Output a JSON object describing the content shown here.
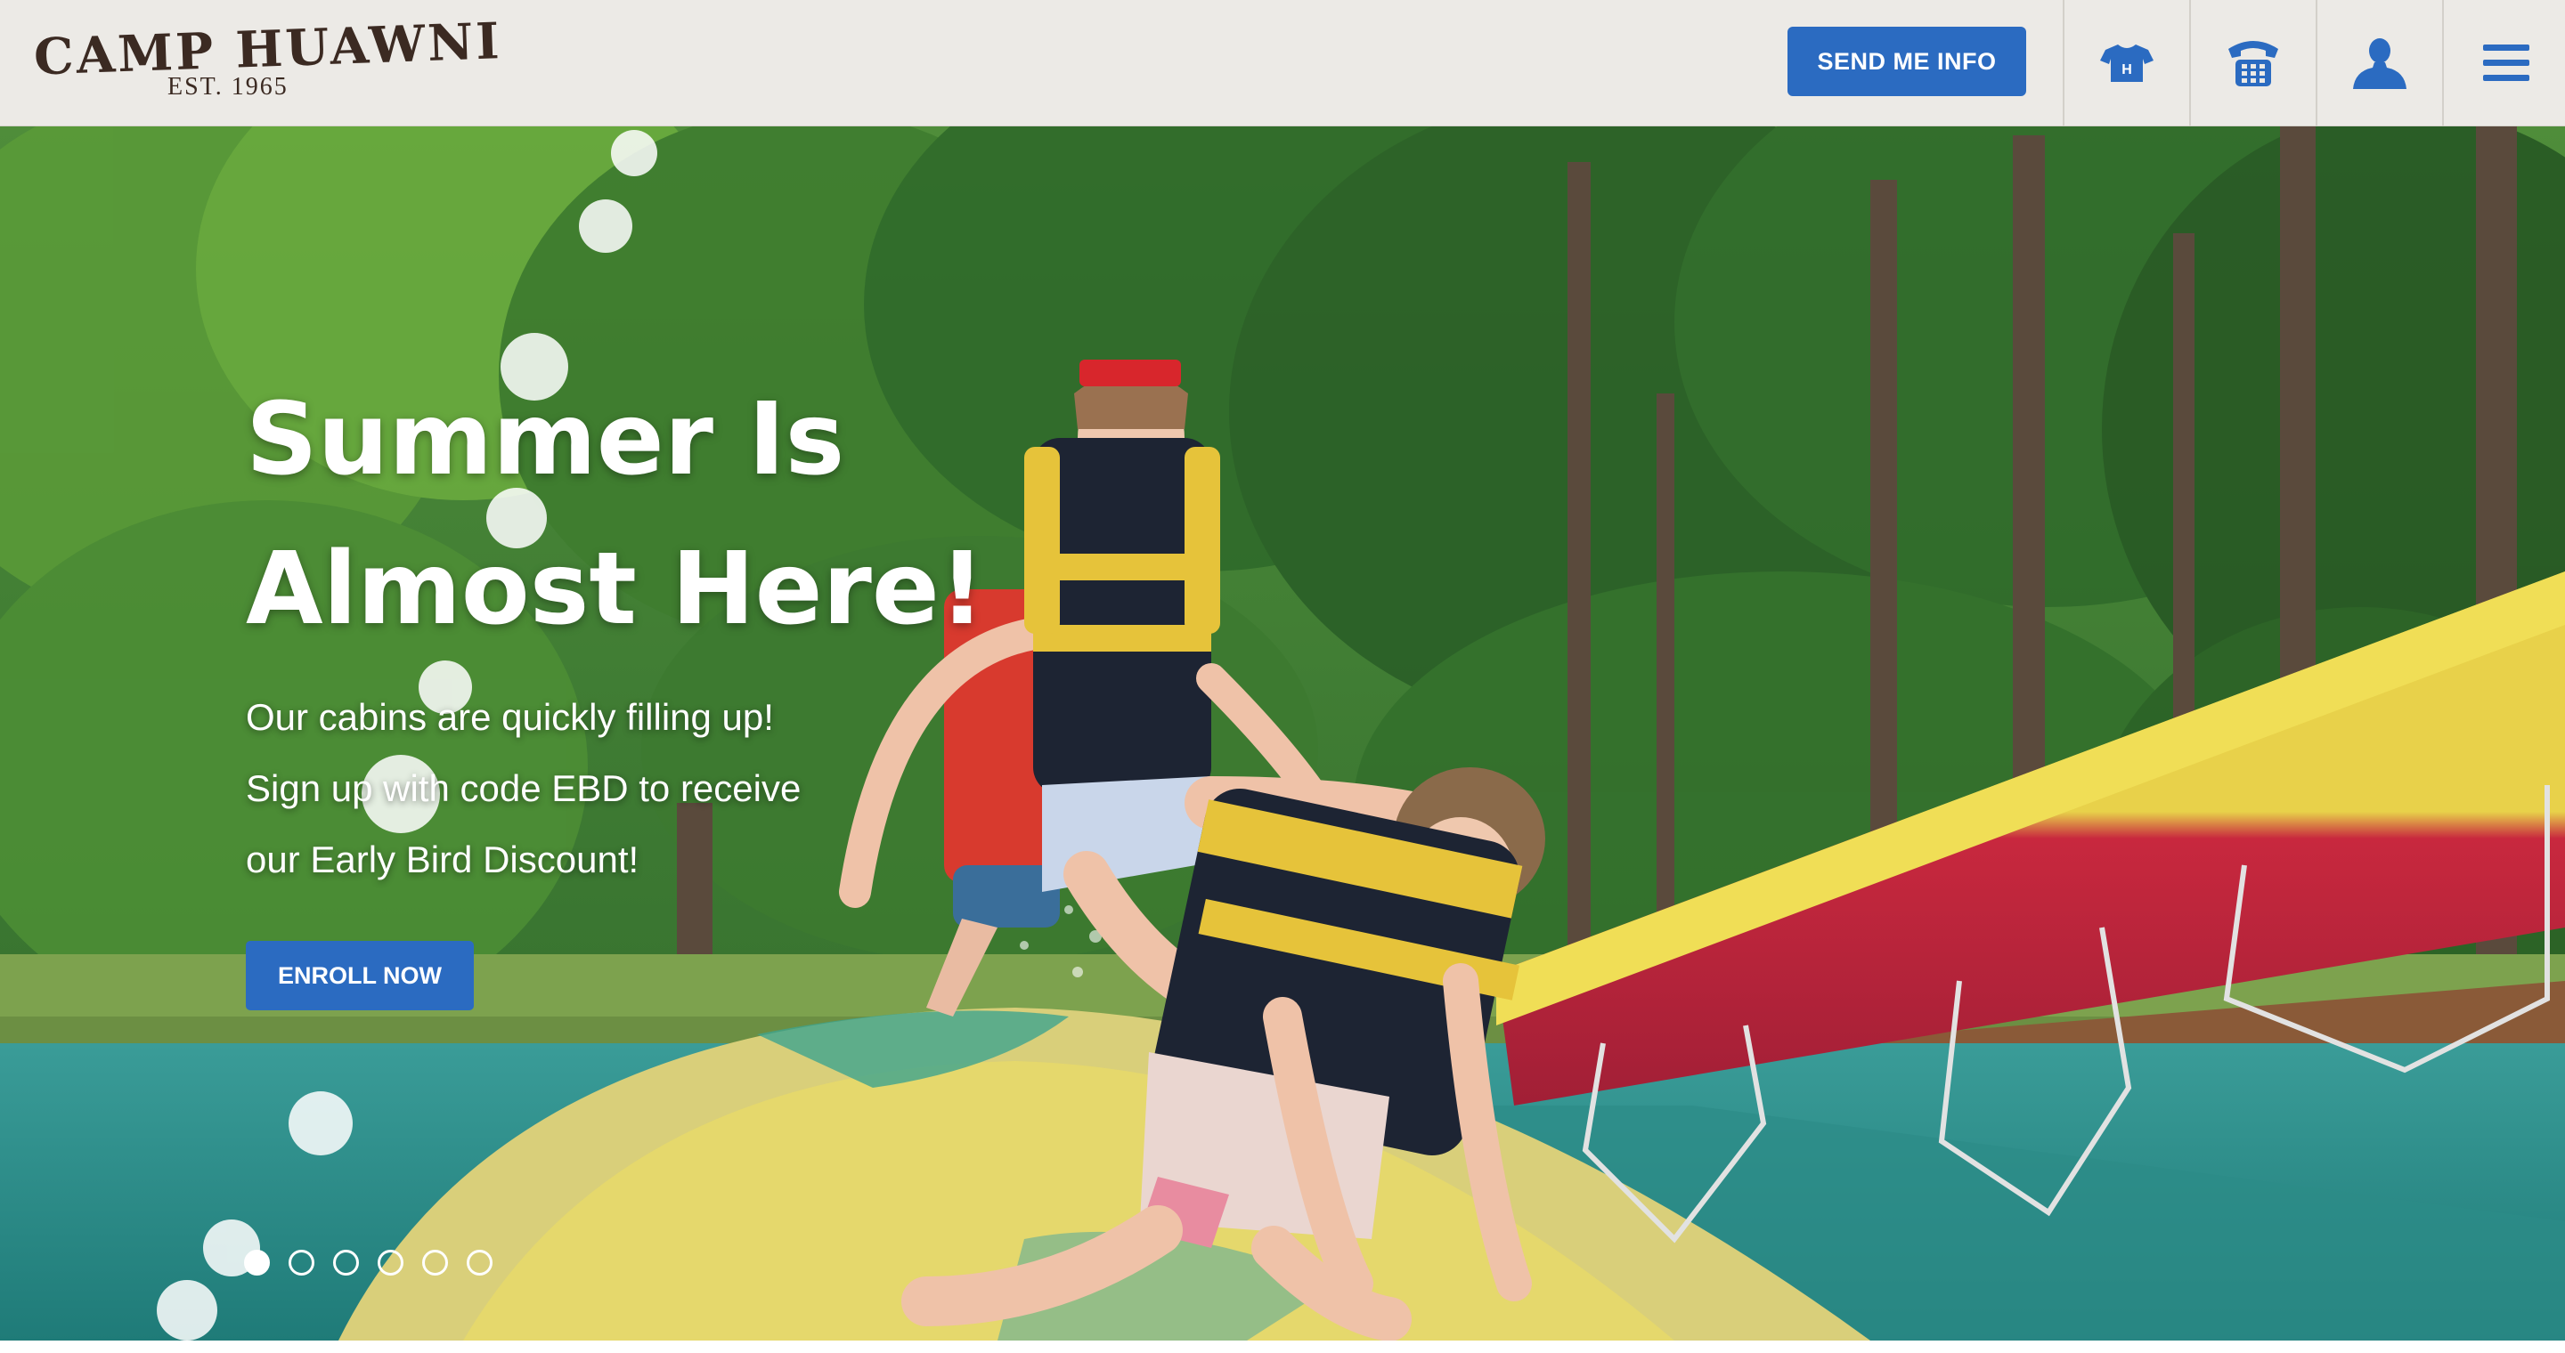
{
  "brand": {
    "name": "CAMP HUAWNI",
    "est": "EST. 1965",
    "text_color": "#3b2a22"
  },
  "header": {
    "background": "#eceae6",
    "send_info_label": "SEND ME INFO",
    "icons": [
      "tshirt-icon",
      "phone-icon",
      "user-icon",
      "menu-icon"
    ],
    "tshirt_letter": "H"
  },
  "hero": {
    "headline": "Summer Is Almost Here!",
    "sub_lines": [
      "Our cabins are quickly filling up!",
      "Sign up with code EBD to receive",
      "our Early Bird Discount!"
    ],
    "enroll_label": "ENROLL NOW",
    "slides_total": 6,
    "active_slide": 1
  },
  "colors": {
    "accent": "#2b6bc1",
    "white": "#ffffff"
  }
}
